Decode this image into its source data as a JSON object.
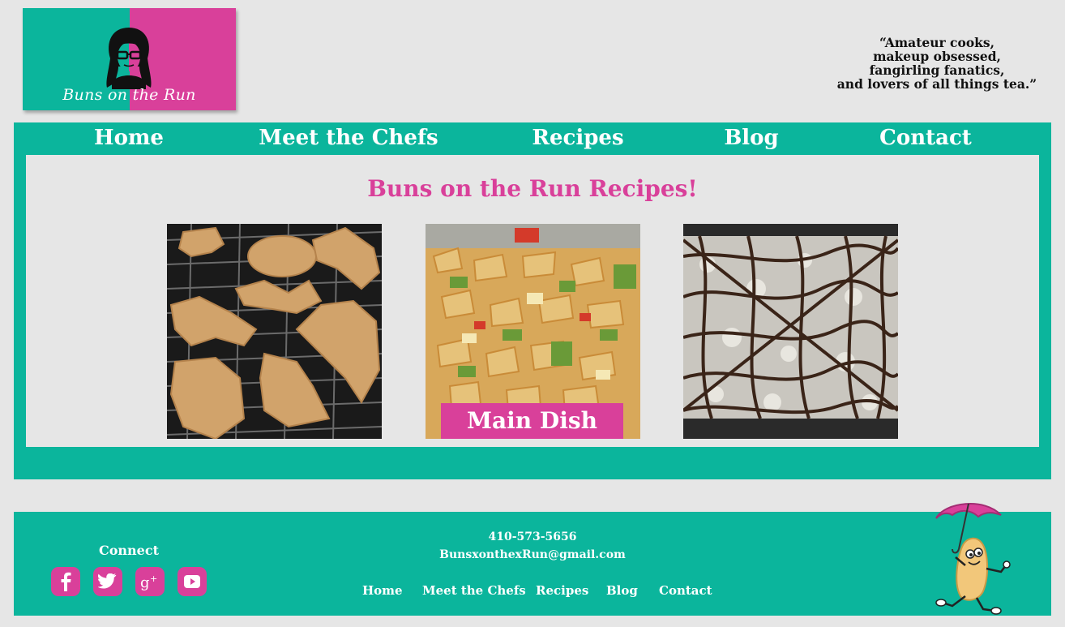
{
  "logo": {
    "text": "Buns on the Run"
  },
  "tagline": [
    "“Amateur cooks,",
    "makeup obsessed,",
    "fangirling fanatics,",
    "and lovers of all things tea.”"
  ],
  "nav": [
    "Home",
    "Meet the Chefs",
    "Recipes",
    "Blog",
    "Contact"
  ],
  "page_title": "Buns on the Run Recipes!",
  "cards": [
    {
      "image": "cookies-photo",
      "label": ""
    },
    {
      "image": "pasta-photo",
      "label": "Main Dish"
    },
    {
      "image": "chocolate-bars-photo",
      "label": ""
    }
  ],
  "footer": {
    "connect_label": "Connect",
    "social": [
      "facebook-icon",
      "twitter-icon",
      "google-plus-icon",
      "youtube-icon"
    ],
    "phone": "410-573-5656",
    "email": "BunsxonthexRun@gmail.com",
    "nav": [
      "Home",
      "Meet the Chefs",
      "Recipes",
      "Blog",
      "Contact"
    ]
  },
  "colors": {
    "teal": "#0bb59c",
    "pink": "#d9409a",
    "background": "#e6e6e6"
  }
}
